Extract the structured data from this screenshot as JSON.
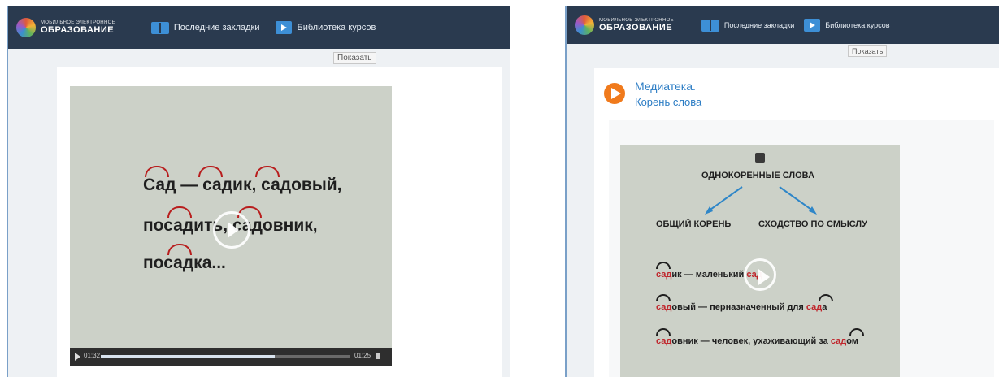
{
  "header": {
    "logo_sub": "МОБИЛЬНОЕ ЭЛЕКТРОННОЕ",
    "logo_main": "ОБРАЗОВАНИЕ",
    "bookmarks_label": "Последние закладки",
    "library_label": "Библиотека курсов"
  },
  "show_button": "Показать",
  "left_video": {
    "line1": "Сад — садик, садовый,",
    "line2": "посадить, садовник,",
    "line3": "посадка...",
    "time_current": "01:32",
    "time_total": "01:25",
    "progress": 0.7
  },
  "right_panel": {
    "media_title": "Медиатека.",
    "media_subtitle": "Корень слова",
    "diagram": {
      "top": "ОДНОКОРЕННЫЕ СЛОВА",
      "left": "ОБЩИЙ КОРЕНЬ",
      "right": "СХОДСТВО ПО СМЫСЛУ"
    },
    "examples": {
      "ex1_root": "сад",
      "ex1_rest": "ик — маленький",
      "ex1_end": "сад",
      "ex2_root": "сад",
      "ex2_rest": "овый — перназначенный для",
      "ex2_end_root": "сад",
      "ex2_end_rest": "а",
      "ex3_root": "сад",
      "ex3_rest": "овник — человек, ухаживающий за",
      "ex3_end_root": "сад",
      "ex3_end_rest": "ом"
    }
  }
}
